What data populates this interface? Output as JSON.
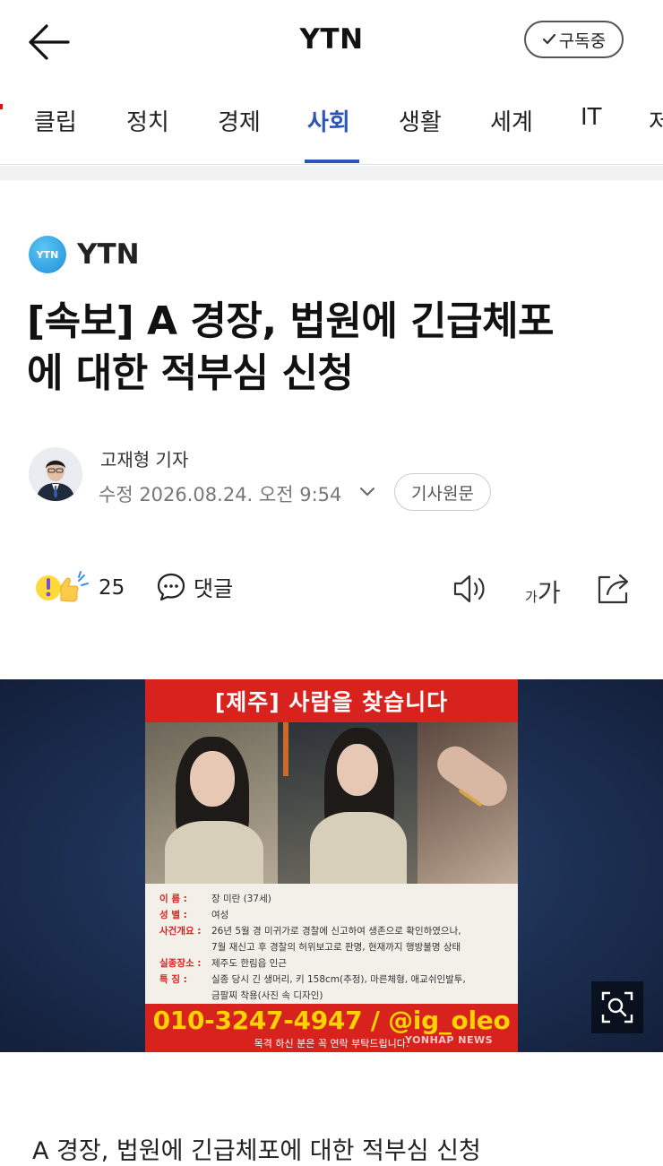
{
  "header": {
    "title": "YTN",
    "subscribe_label": "구독중"
  },
  "tabs": [
    {
      "label": "클립",
      "active": false
    },
    {
      "label": "정치",
      "active": false
    },
    {
      "label": "경제",
      "active": false
    },
    {
      "label": "사회",
      "active": true
    },
    {
      "label": "생활",
      "active": false
    },
    {
      "label": "세계",
      "active": false
    },
    {
      "label": "IT",
      "active": false
    },
    {
      "label": "저",
      "active": false
    }
  ],
  "article": {
    "press_logo_text": "YTN",
    "press_name": "YTN",
    "headline_line1": "[속보] A 경장, 법원에 긴급체포",
    "headline_line2": "에 대한 적부심 신청",
    "author": "고재형 기자",
    "timestamp": "수정 2026.08.24. 오전 9:54",
    "original_link_label": "기사원문",
    "body_preview": "A 경장, 법원에 긴급체포에 대한 적부심 신청"
  },
  "actions": {
    "reaction_count": "25",
    "comment_label": "댓글",
    "font_small": "가",
    "font_big": "가"
  },
  "image": {
    "poster_title": "[제주] 사람을 찾습니다",
    "info": [
      {
        "key": "이    름 :",
        "value": "장 미란 (37세)"
      },
      {
        "key": "성    별 :",
        "value": "여성"
      },
      {
        "key": "사건개요 :",
        "value": "26년 5월 경 미귀가로 경찰에 신고하여 생존으로 확인하였으나,"
      },
      {
        "key": "",
        "value": "7월 재신고 후 경찰의 허위보고로 판명, 현재까지 행방불명 상태"
      },
      {
        "key": "실종장소 :",
        "value": "제주도 한림읍 인근"
      },
      {
        "key": "특    징 :",
        "value": "실종 당시 긴 생머리, 키 158cm(추정), 마른체형, 애교쉬인발투,"
      },
      {
        "key": "",
        "value": "금팔찌 착용(사진 속 디자인)"
      }
    ],
    "contact": "010-3247-4947 / @ig_oleo",
    "contact_note": "목격 하신 분은 꼭 연락 부탁드립니다.",
    "watermark": "YONHAP NEWS"
  },
  "colors": {
    "accent": "#2d55b8",
    "poster_red": "#d8221e",
    "poster_yellow": "#ffd200"
  }
}
